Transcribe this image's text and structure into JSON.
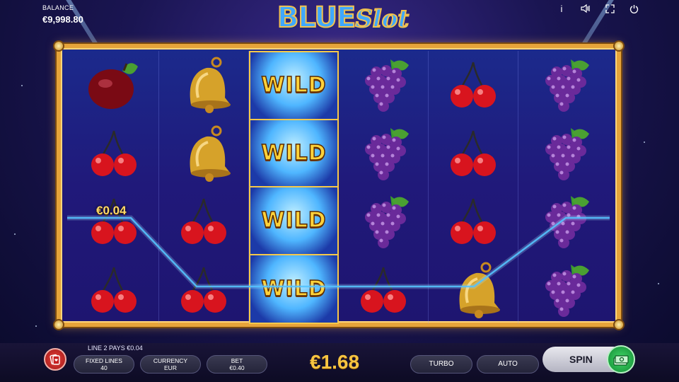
{
  "header": {
    "balance_label": "BALANCE",
    "balance_value": "€9,998.80",
    "logo_part1": "BLUE",
    "logo_part2": "Slot"
  },
  "top_icons": [
    "info-icon",
    "sound-icon",
    "fullscreen-icon",
    "power-icon"
  ],
  "reels": [
    [
      "plum",
      "cherry",
      "cherry",
      "cherry"
    ],
    [
      "bell",
      "bell",
      "cherry",
      "cherry"
    ],
    [
      "wild",
      "wild",
      "wild",
      "wild"
    ],
    [
      "grapes",
      "grapes",
      "grapes",
      "cherry"
    ],
    [
      "cherry",
      "cherry",
      "cherry",
      "bell"
    ],
    [
      "grapes",
      "grapes",
      "grapes",
      "grapes"
    ]
  ],
  "wild_label": "WILD",
  "win_amount": "€0.04",
  "bottom": {
    "pays_info": "LINE 2 PAYS €0.04",
    "fixed_lines_label": "FIXED LINES",
    "fixed_lines_value": "40",
    "currency_label": "CURRENCY",
    "currency_value": "EUR",
    "bet_label": "BET",
    "bet_value": "€0.40",
    "total_win": "€1.68",
    "turbo": "TURBO",
    "auto": "AUTO",
    "spin": "SPIN"
  },
  "colors": {
    "frame_gold": "#e6a43a",
    "reel_bg": "#20197a",
    "win_text": "#f6c441",
    "spin_green": "#2fb85a",
    "gamble_red": "#d22a2a"
  }
}
